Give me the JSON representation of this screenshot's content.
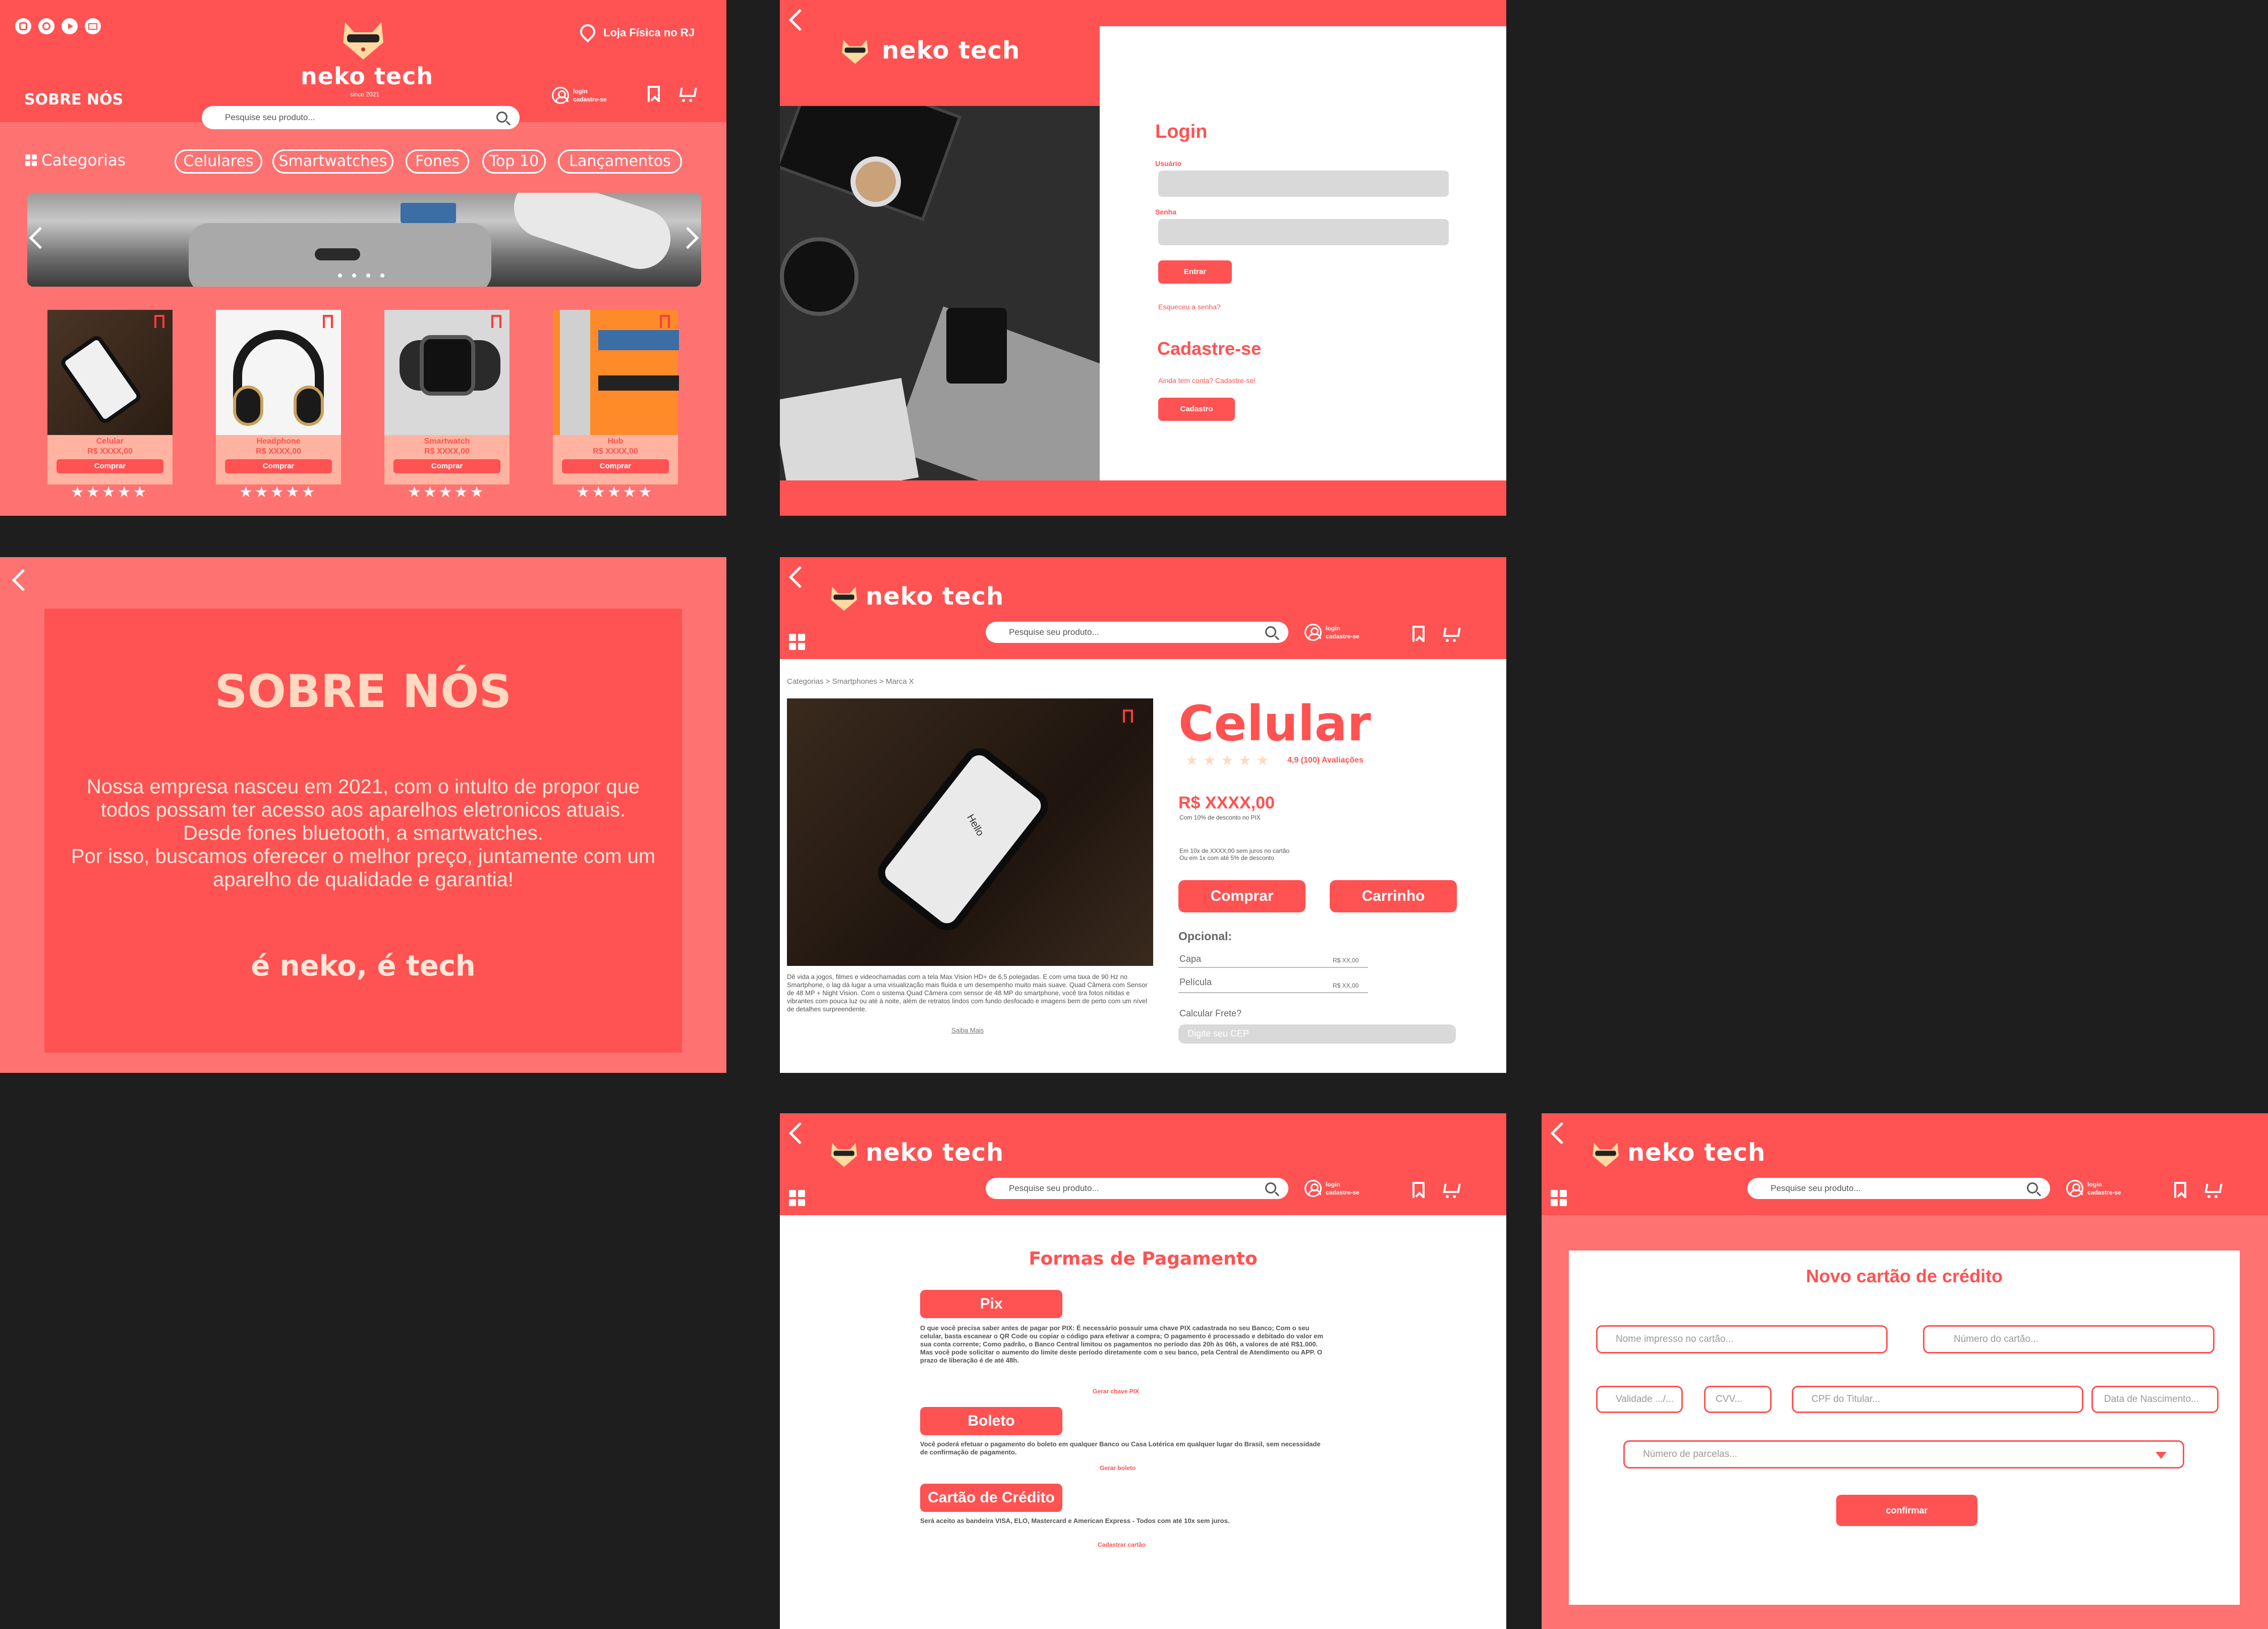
{
  "brand": {
    "name": "neko tech",
    "since": "since 2021"
  },
  "home": {
    "store": "Loja Física no RJ",
    "about_link": "SOBRE NÓS",
    "search_placeholder": "Pesquise seu produto...",
    "login": "login",
    "signup": "cadastre-se",
    "categories_label": "Categorias",
    "categories": [
      "Celulares",
      "Smartwatches",
      "Fones",
      "Top 10",
      "Lançamentos"
    ],
    "products": [
      {
        "name": "Celular",
        "price": "R$ XXXX,00",
        "buy": "Comprar",
        "rating": 5
      },
      {
        "name": "Headphone",
        "price": "R$ XXXX,00",
        "buy": "Comprar",
        "rating": 5
      },
      {
        "name": "Smartwatch",
        "price": "R$ XXXX,00",
        "buy": "Comprar",
        "rating": 5
      },
      {
        "name": "Hub",
        "price": "R$ XXXX,00",
        "buy": "Comprar",
        "rating": 5
      }
    ],
    "stars": "★★★★★"
  },
  "login": {
    "title": "Login",
    "user_label": "Usuário",
    "pass_label": "Senha",
    "enter": "Entrar",
    "forgot": "Esqueceu a senha?",
    "signup_title": "Cadastre-se",
    "no_account": "Ainda tem conta? Cadastre-se!",
    "signup_button": "Cadastro"
  },
  "about": {
    "title": "SOBRE NÓS",
    "text1": "Nossa empresa nasceu em 2021, com o intulto de propor que todos possam ter acesso aos aparelhos eletronicos atuais.",
    "text2": "Desde fones bluetooth, a smartwatches.",
    "text3": "Por isso, buscamos oferecer o melhor preço, juntamente com um aparelho de qualidade e garantia!",
    "slogan": "é neko, é tech"
  },
  "product": {
    "breadcrumb": "Categorias > Smartphones > Marca X",
    "title": "Celular",
    "stars": "★★★★★",
    "rating": "4,9 (100) Avaliações",
    "price": "R$ XXXX,00",
    "pix_note": "Com 10% de desconto no PIX",
    "installments1": "Em 10x de XXXX,00 sem juros no cartão",
    "installments2": "Ou em 1x com até 5% de desconto",
    "buy": "Comprar",
    "cart": "Carrinho",
    "optional": "Opcional:",
    "opt1": "Capa",
    "opt1_price": "R$ XX,00",
    "opt2": "Película",
    "opt2_price": "R$ XX,00",
    "shipping": "Calcular Frete?",
    "cep_placeholder": "Digite seu CEP",
    "description": "Dê vida a jogos, filmes e videochamadas com a tela Max Vision HD+ de 6,5 polegadas. E com uma taxa de 90 Hz no Smartphone, o lag dá lugar a uma visualização mais fluida e um desempenho muito mais suave. Quad Câmera com Sensor de 48 MP + Night Vision. Com o sistema Quad Câmera com sensor de 48 MP do smartphone, você tira fotos nítidas e vibrantes com pouca luz ou até à noite, além de retratos lindos com fundo desfocado e imagens bem de perto com um nível de detalhes surpreendente.",
    "more": "Saiba Mais",
    "screen_text": "Hello"
  },
  "payment": {
    "title": "Formas de Pagamento",
    "pix": "Pix",
    "pix_text": "O que você precisa saber antes de pagar por PIX: É necessário possuir uma chave PIX cadastrada no seu Banco; Com o seu celular, basta escanear o QR Code ou copiar o código para efetivar a compra; O pagamento é processado e debitado do valor em sua conta corrente; Como padrão, o Banco Central limitou os pagamentos no período das 20h às 06h, a valores de até R$1.000. Mas você pode solicitar o aumento do limite deste período diretamente com o seu banco, pela Central de Atendimento ou APP. O prazo de liberação é de até 48h.",
    "pix_link": "Gerar chave PIX",
    "boleto": "Boleto",
    "boleto_text": "Você poderá efetuar o pagamento do boleto em qualquer Banco ou Casa Lotérica em qualquer lugar do Brasil, sem necessidade de confirmação de pagamento.",
    "boleto_link": "Gerar boleto",
    "card": "Cartão de Crédito",
    "card_text": "Será aceito as bandeira VISA, ELO, Mastercard e American Express - Todos com até 10x sem juros.",
    "card_link": "Cadastrar cartão"
  },
  "newcard": {
    "title": "Novo cartão de crédito",
    "name_ph": "Nome impresso no cartão...",
    "number_ph": "Número do cartão...",
    "validity_ph": "Validade .../...",
    "cvv_ph": "CVV...",
    "cpf_ph": "CPF do Titular...",
    "birth_ph": "Data de Nascimento...",
    "installments_ph": "Número de parcelas...",
    "confirm": "confirmar"
  },
  "colors": {
    "primary": "#ff5252",
    "salmon": "#ff7272",
    "peach": "#ffb3a0",
    "background": "#1e1e1e"
  }
}
